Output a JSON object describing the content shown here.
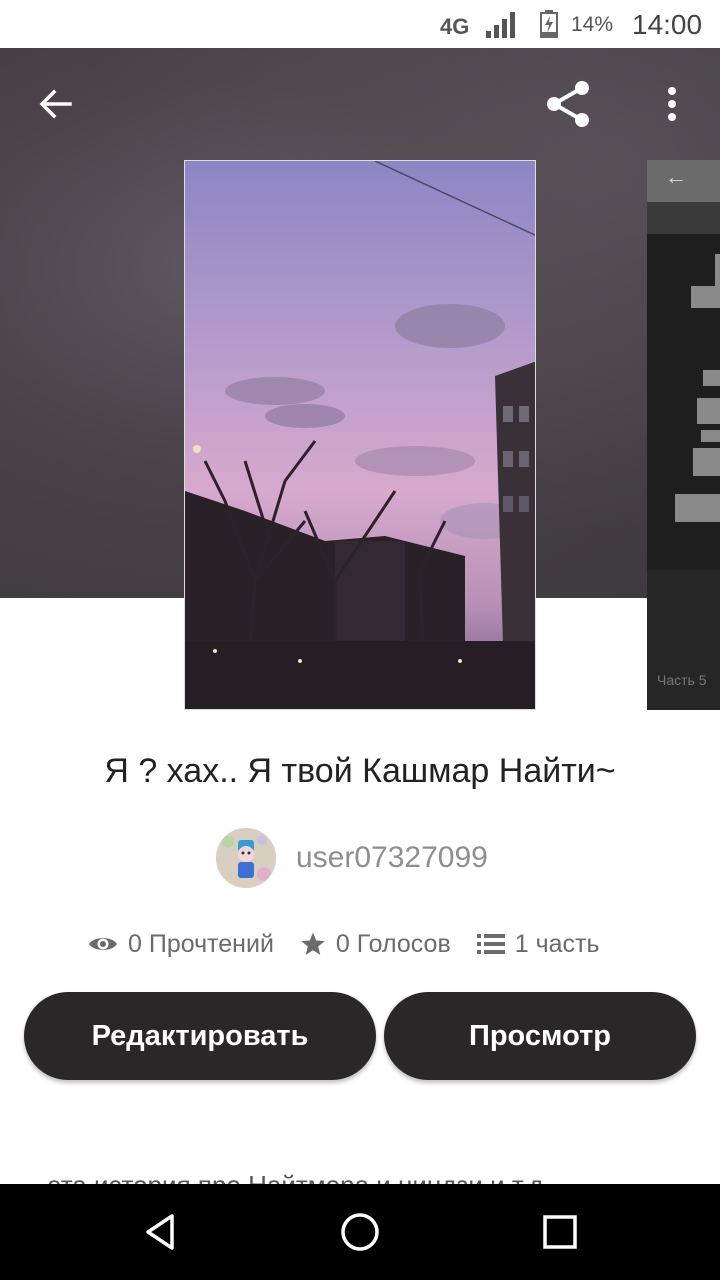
{
  "status_bar": {
    "network": "4G",
    "battery_percent": "14%",
    "time": "14:00"
  },
  "header": {
    "icons": [
      "back-arrow-icon",
      "share-icon",
      "more-vertical-icon"
    ]
  },
  "next_cover": {
    "label": "Часть 5"
  },
  "story": {
    "title": "Я ?  хах.. Я твой Кашмар Найти~",
    "author": "user07327099",
    "stats": {
      "reads": "0 Прочтений",
      "votes": "0 Голосов",
      "parts": "1 часть"
    }
  },
  "actions": {
    "edit_label": "Редактировать",
    "view_label": "Просмотр"
  },
  "description_peek": "эта история про Найтмера и ниндзи и т.д",
  "nav_bar": {
    "icons": [
      "nav-back-icon",
      "nav-home-icon",
      "nav-recents-icon"
    ]
  },
  "colors": {
    "button_bg": "#2a2728",
    "header_bg": "#4a4349",
    "muted_text": "#8e8e8e"
  }
}
